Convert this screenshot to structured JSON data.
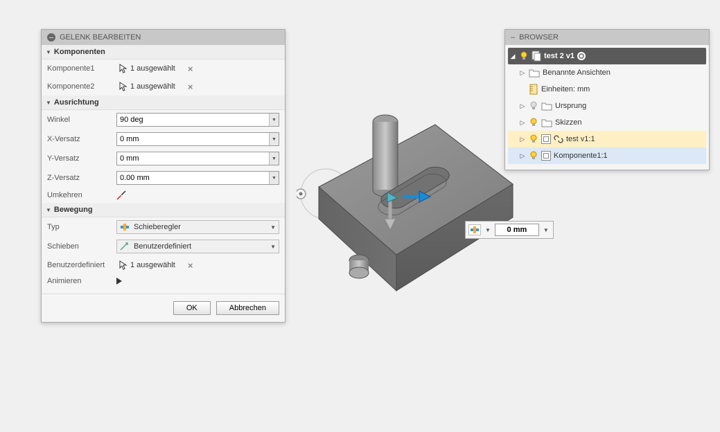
{
  "dialog": {
    "title": "GELENK BEARBEITEN",
    "sections": {
      "components": {
        "header": "Komponenten",
        "rows": [
          {
            "label": "Komponente1",
            "value": "1 ausgewählt"
          },
          {
            "label": "Komponente2",
            "value": "1 ausgewählt"
          }
        ]
      },
      "alignment": {
        "header": "Ausrichtung",
        "angle_label": "Winkel",
        "angle_value": "90 deg",
        "x_label": "X-Versatz",
        "x_value": "0 mm",
        "y_label": "Y-Versatz",
        "y_value": "0 mm",
        "z_label": "Z-Versatz",
        "z_value": "0.00 mm",
        "flip_label": "Umkehren"
      },
      "motion": {
        "header": "Bewegung",
        "type_label": "Typ",
        "type_value": "Schieberegler",
        "slide_label": "Schieben",
        "slide_value": "Benutzerdefiniert",
        "custom_label": "Benutzerdefiniert",
        "custom_value": "1 ausgewählt",
        "animate_label": "Animieren"
      }
    },
    "footer": {
      "ok": "OK",
      "cancel": "Abbrechen"
    }
  },
  "browser": {
    "title": "BROWSER",
    "root": "test 2 v1",
    "items": [
      {
        "label": "Benannte Ansichten"
      },
      {
        "label": "Einheiten: mm"
      },
      {
        "label": "Ursprung"
      },
      {
        "label": "Skizzen"
      },
      {
        "label": "test v1:1"
      },
      {
        "label": "Komponente1:1"
      }
    ]
  },
  "floating": {
    "value": "0 mm"
  }
}
